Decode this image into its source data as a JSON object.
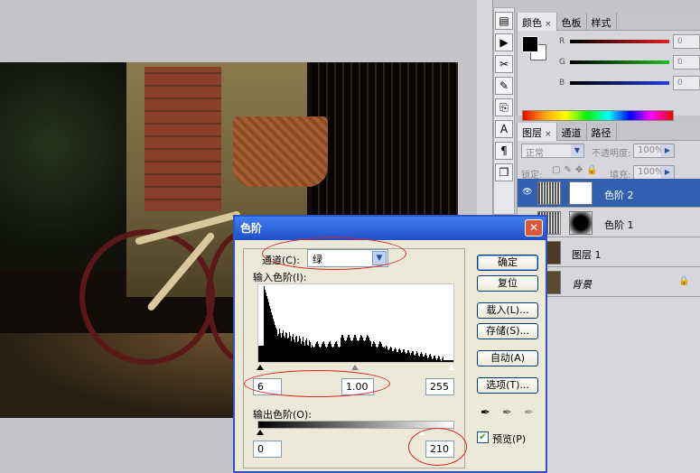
{
  "color_panel": {
    "tabs": [
      {
        "label": "颜色",
        "close": "×"
      },
      {
        "label": "色板"
      },
      {
        "label": "样式"
      }
    ],
    "channels": [
      {
        "label": "R",
        "value": "0",
        "color": "#e02020"
      },
      {
        "label": "G",
        "value": "0",
        "color": "#20c020"
      },
      {
        "label": "B",
        "value": "0",
        "color": "#2040e0"
      }
    ]
  },
  "layers_panel": {
    "tabs": [
      {
        "label": "图层",
        "close": "×"
      },
      {
        "label": "通道"
      },
      {
        "label": "路径"
      }
    ],
    "blend_mode": "正常",
    "opacity_label": "不透明度:",
    "opacity_value": "100%",
    "lock_label": "锁定:",
    "fill_label": "填充:",
    "fill_value": "100%",
    "layers": [
      {
        "name": "色阶 2",
        "selected": true
      },
      {
        "name": "色阶 1",
        "selected": false
      },
      {
        "name": "图层 1",
        "selected": false
      },
      {
        "name": "背景",
        "selected": false
      }
    ]
  },
  "levels_dialog": {
    "title": "色阶",
    "close": "✕",
    "channel_label": "通道(C):",
    "channel_value": "绿",
    "input_levels_label": "输入色阶(I):",
    "input_black": "6",
    "input_gamma": "1.00",
    "input_white": "255",
    "output_levels_label": "输出色阶(O):",
    "output_black": "0",
    "output_white": "210",
    "buttons": {
      "ok": "确定",
      "reset": "复位",
      "load": "载入(L)...",
      "save": "存储(S)...",
      "auto": "自动(A)",
      "options": "选项(T)..."
    },
    "preview_label": "预览(P)",
    "preview_checked": true
  },
  "accent_colors": {
    "title_bar": "#2150c9",
    "selection": "#3160b0",
    "highlight_ring": "#dd2222"
  }
}
